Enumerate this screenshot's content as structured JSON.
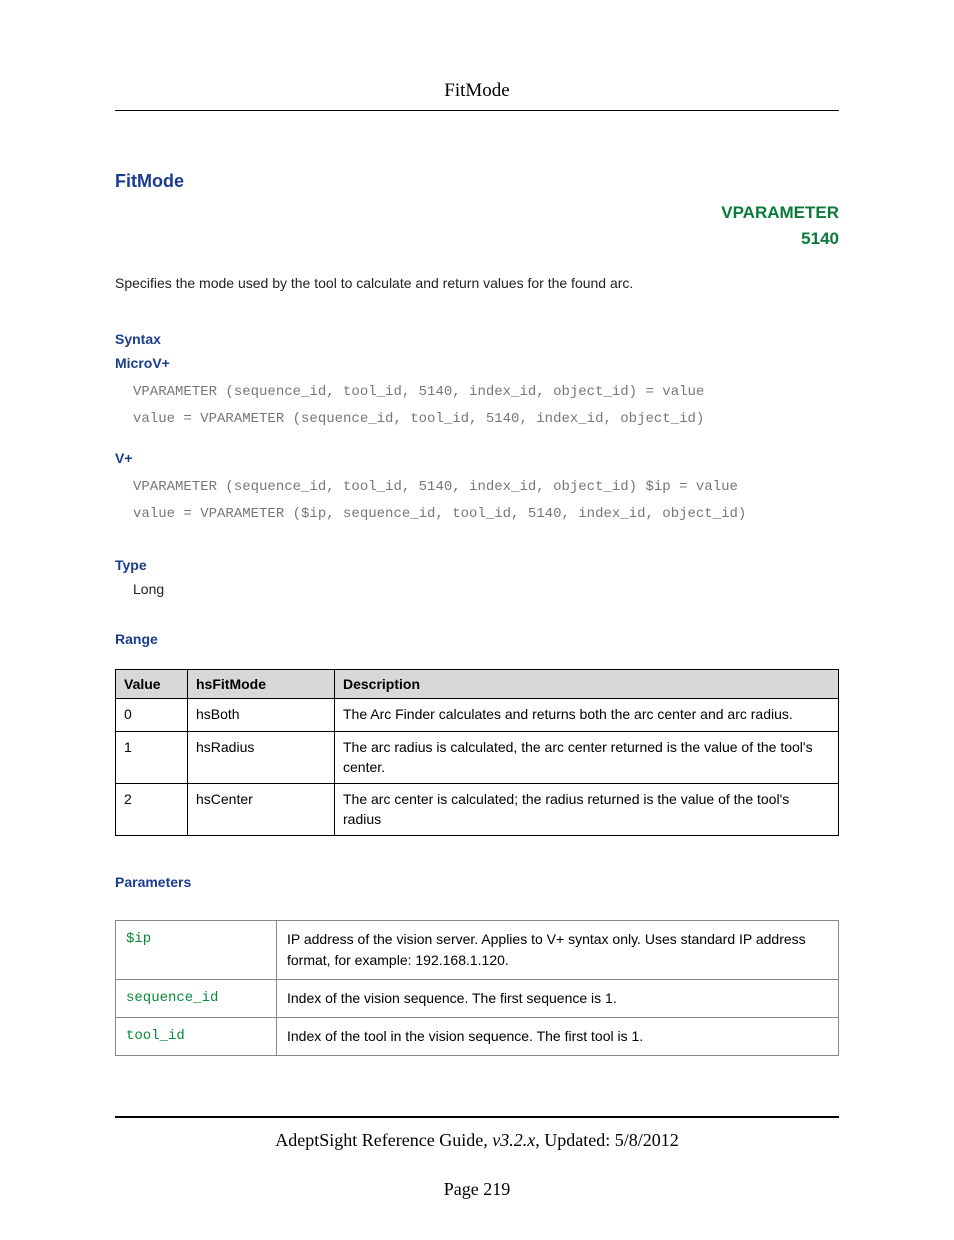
{
  "header": {
    "title": "FitMode"
  },
  "main": {
    "title": "FitMode",
    "vparam_label": "VPARAMETER",
    "vparam_number": "5140",
    "description": "Specifies the mode used by the tool to calculate and return values for the found arc."
  },
  "syntax": {
    "heading": "Syntax",
    "microv": {
      "label": "MicroV+",
      "line1": "VPARAMETER (sequence_id, tool_id, 5140, index_id, object_id) = value",
      "line2": "value = VPARAMETER (sequence_id, tool_id, 5140, index_id, object_id)"
    },
    "vplus": {
      "label": "V+",
      "line1": "VPARAMETER (sequence_id, tool_id, 5140, index_id, object_id) $ip = value",
      "line2": "value = VPARAMETER ($ip, sequence_id, tool_id, 5140, index_id, object_id)"
    }
  },
  "type_section": {
    "heading": "Type",
    "value": "Long"
  },
  "range_section": {
    "heading": "Range",
    "headers": {
      "c0": "Value",
      "c1": "hsFitMode",
      "c2": "Description"
    },
    "rows": [
      {
        "c0": "0",
        "c1": "hsBoth",
        "c2": "The Arc Finder calculates and returns both the arc center and arc radius."
      },
      {
        "c0": "1",
        "c1": "hsRadius",
        "c2": "The arc radius is calculated, the arc center returned is the value of the tool's center."
      },
      {
        "c0": "2",
        "c1": "hsCenter",
        "c2": "The arc center is calculated; the radius returned is the value of the tool's radius"
      }
    ]
  },
  "params_section": {
    "heading": "Parameters",
    "rows": [
      {
        "name": "$ip",
        "desc": "IP address of the vision server. Applies to V+ syntax only. Uses standard IP address format, for example: 192.168.1.120."
      },
      {
        "name": "sequence_id",
        "desc": "Index of the vision sequence. The first sequence is 1."
      },
      {
        "name": "tool_id",
        "desc": "Index of the tool in the vision sequence. The first tool is 1."
      }
    ]
  },
  "footer": {
    "guide": "AdeptSight Reference Guide",
    "version": ", v3.2.x",
    "updated": ", Updated: 5/8/2012",
    "page": "Page 219"
  }
}
